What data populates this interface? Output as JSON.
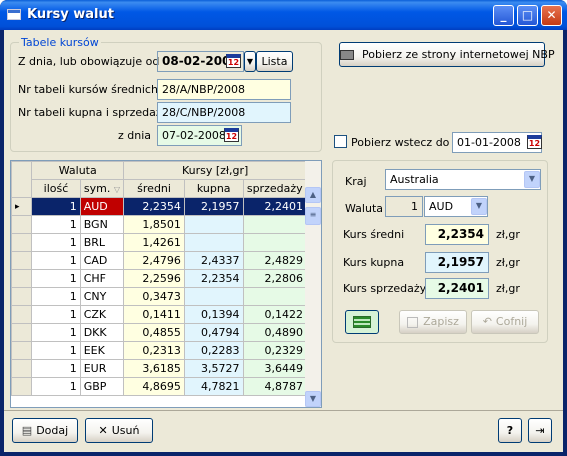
{
  "window": {
    "title": "Kursy walut"
  },
  "tables": {
    "group_label": "Tabele kursów",
    "date_label": "Z dnia, lub obowiązuje od",
    "date_value": "08-02-2008",
    "list_label": "Lista",
    "avg_label": "Nr tabeli kursów średnich",
    "avg_value": "28/A/NBP/2008",
    "buysell_label": "Nr tabeli kupna i sprzedaży",
    "buysell_value": "28/C/NBP/2008",
    "from_label": "z dnia",
    "from_value": "07-02-2008"
  },
  "fetch": {
    "button_label": "Pobierz ze strony internetowej NBP",
    "back_label": "Pobierz wstecz do",
    "back_date": "01-01-2008"
  },
  "grid": {
    "group_waluta": "Waluta",
    "group_kursy": "Kursy [zł,gr]",
    "col_qty": "ilość",
    "col_sym": "sym.",
    "col_avg": "średni",
    "col_buy": "kupna",
    "col_sell": "sprzedaży",
    "rows": [
      {
        "qty": "1",
        "sym": "AUD",
        "avg": "2,2354",
        "buy": "2,1957",
        "sell": "2,2401"
      },
      {
        "qty": "1",
        "sym": "BGN",
        "avg": "1,8501",
        "buy": "",
        "sell": ""
      },
      {
        "qty": "1",
        "sym": "BRL",
        "avg": "1,4261",
        "buy": "",
        "sell": ""
      },
      {
        "qty": "1",
        "sym": "CAD",
        "avg": "2,4796",
        "buy": "2,4337",
        "sell": "2,4829"
      },
      {
        "qty": "1",
        "sym": "CHF",
        "avg": "2,2596",
        "buy": "2,2354",
        "sell": "2,2806"
      },
      {
        "qty": "1",
        "sym": "CNY",
        "avg": "0,3473",
        "buy": "",
        "sell": ""
      },
      {
        "qty": "1",
        "sym": "CZK",
        "avg": "0,1411",
        "buy": "0,1394",
        "sell": "0,1422"
      },
      {
        "qty": "1",
        "sym": "DKK",
        "avg": "0,4855",
        "buy": "0,4794",
        "sell": "0,4890"
      },
      {
        "qty": "1",
        "sym": "EEK",
        "avg": "0,2313",
        "buy": "0,2283",
        "sell": "0,2329"
      },
      {
        "qty": "1",
        "sym": "EUR",
        "avg": "3,6185",
        "buy": "3,5727",
        "sell": "3,6449"
      },
      {
        "qty": "1",
        "sym": "GBP",
        "avg": "4,8695",
        "buy": "4,7821",
        "sell": "4,8787"
      }
    ]
  },
  "detail": {
    "country_label": "Kraj",
    "country_value": "Australia",
    "currency_label": "Waluta",
    "currency_qty": "1",
    "currency_value": "AUD",
    "avg_label": "Kurs średni",
    "avg_value": "2,2354",
    "buy_label": "Kurs kupna",
    "buy_value": "2,1957",
    "sell_label": "Kurs sprzedaży",
    "sell_value": "2,2401",
    "unit": "zł,gr",
    "save_label": "Zapisz",
    "undo_label": "Cofnij"
  },
  "footer": {
    "add_label": "Dodaj",
    "remove_label": "Usuń",
    "help_label": "?"
  },
  "colors": {
    "selected_row": "#0a246a",
    "avg_bg": "#ffffe1",
    "buy_bg": "#e1f5fd",
    "sell_bg": "#e6fae6"
  }
}
